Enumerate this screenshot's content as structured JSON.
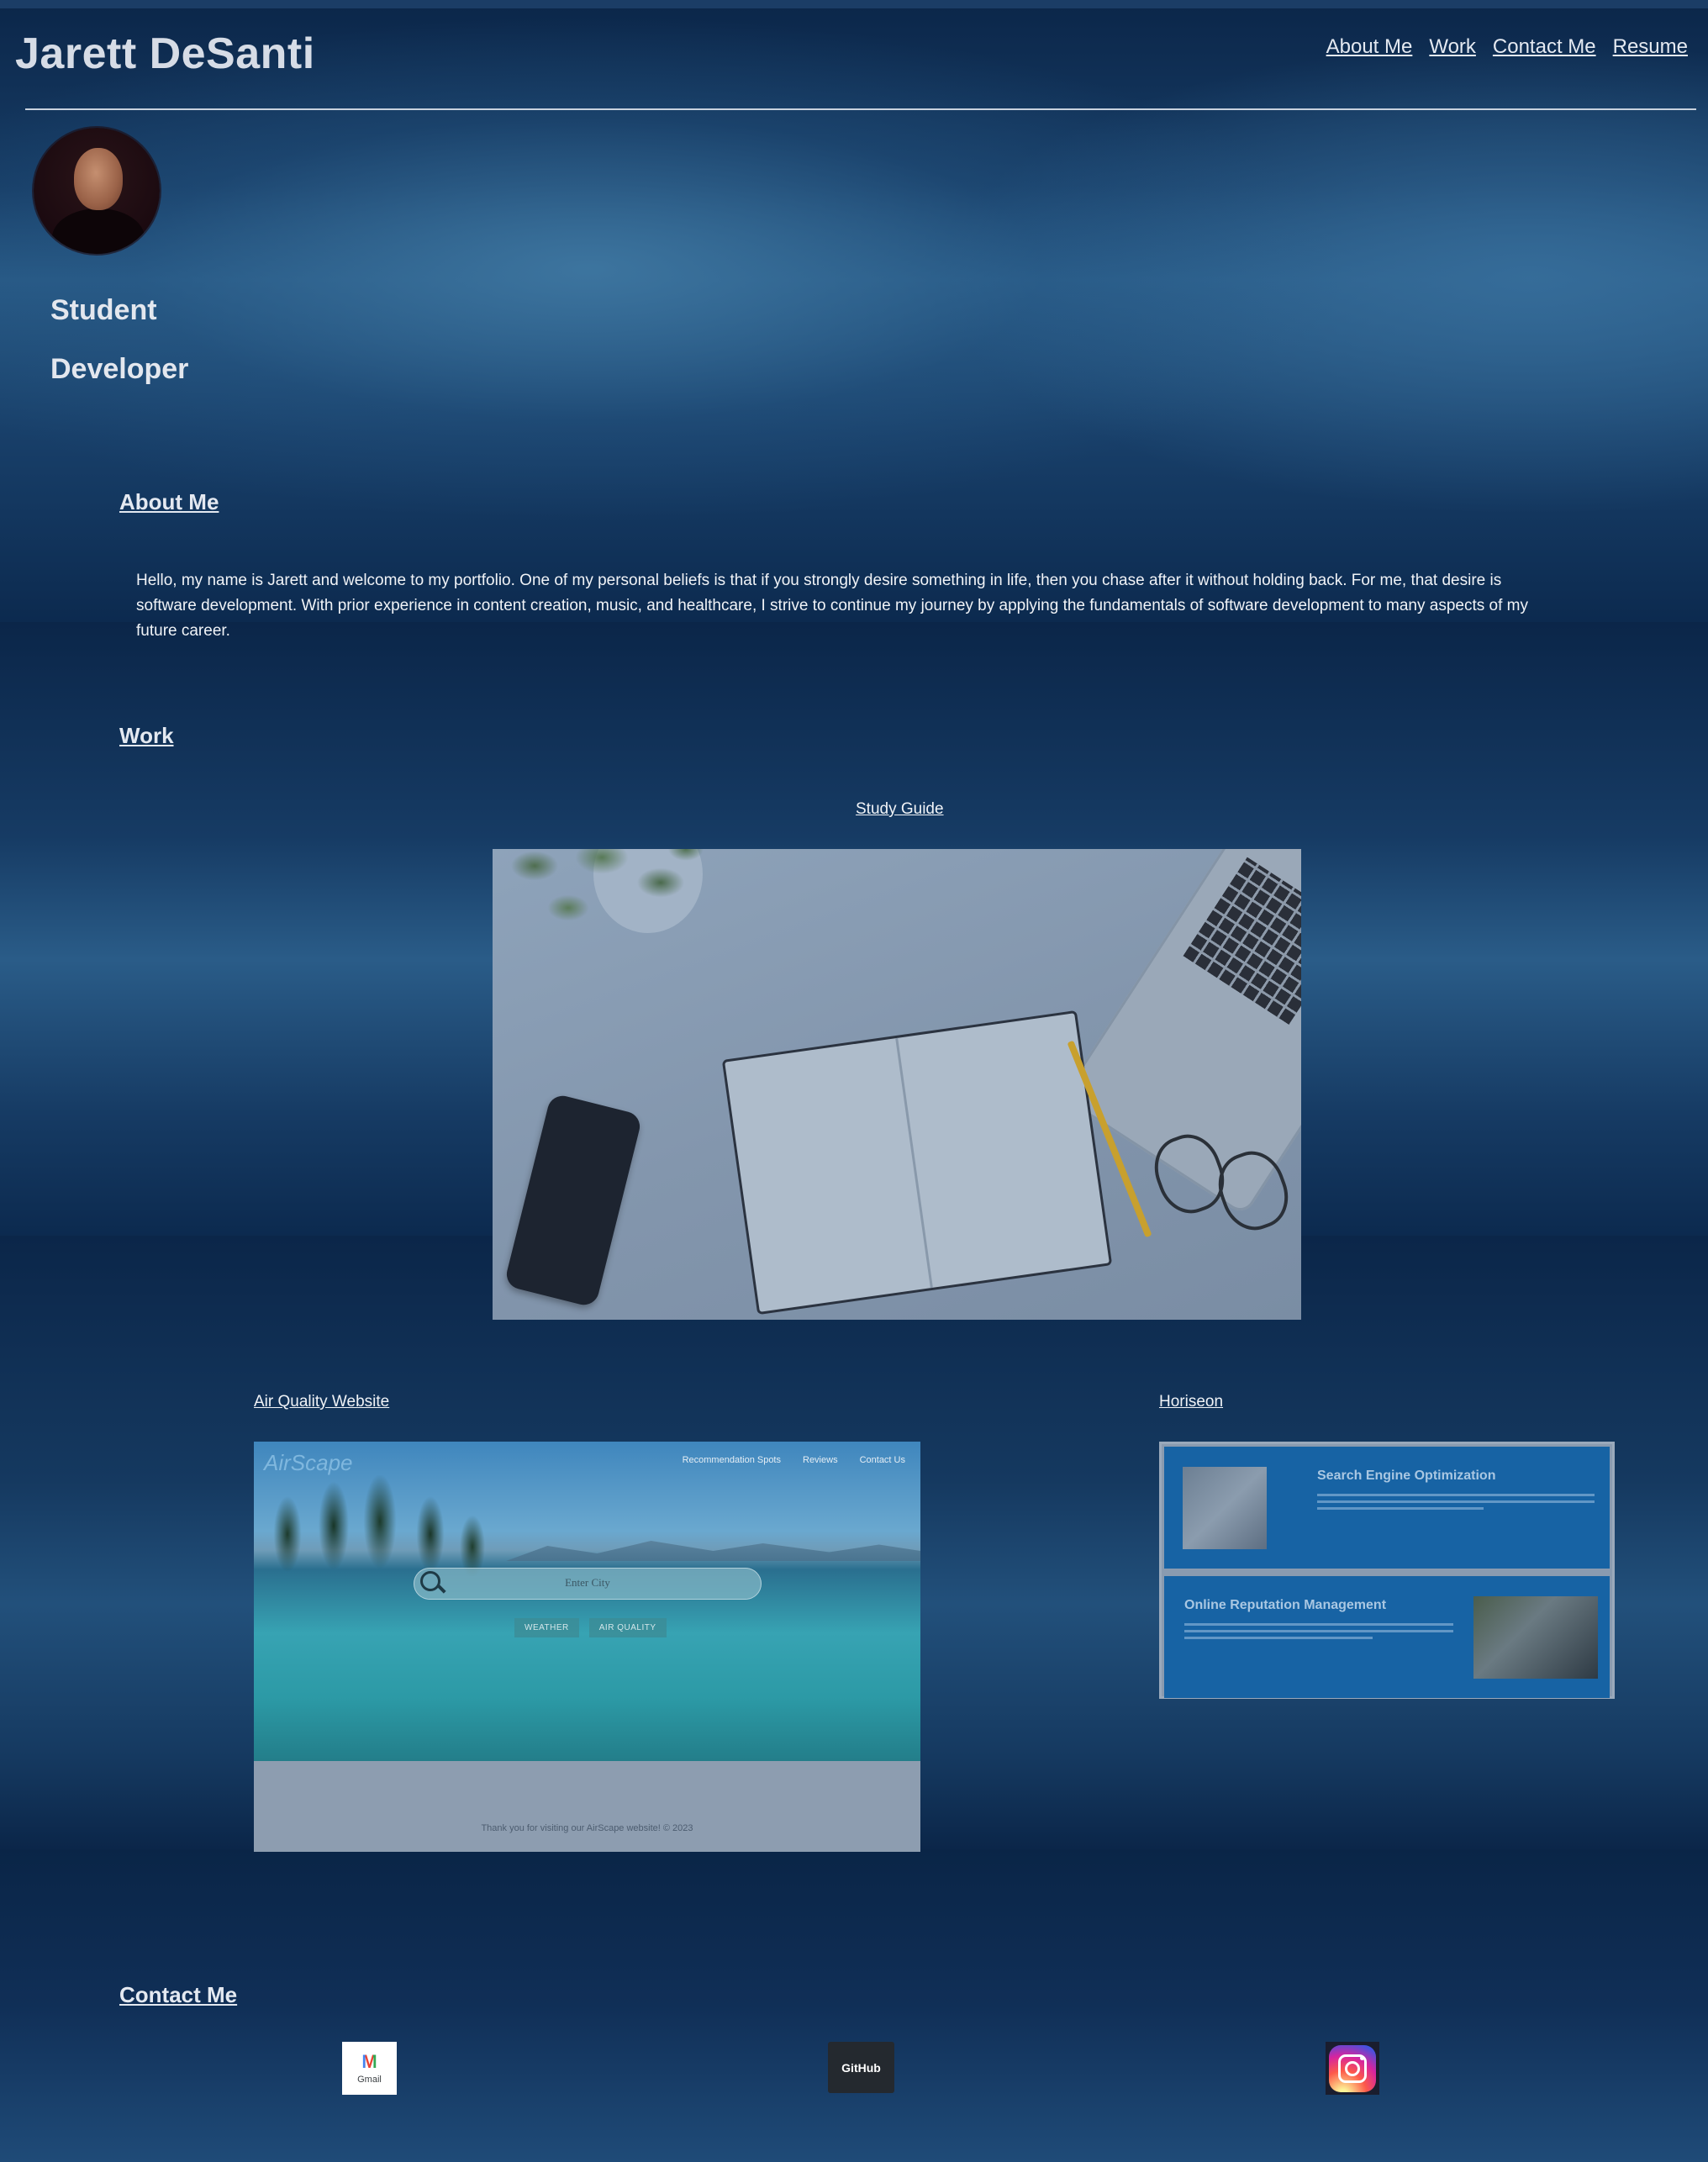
{
  "header": {
    "site_title": "Jarett DeSanti",
    "nav": [
      "About Me",
      "Work",
      "Contact Me",
      "Resume"
    ]
  },
  "hero": {
    "roles": [
      "Student",
      "Developer"
    ]
  },
  "about": {
    "heading": "About Me",
    "text": "Hello, my name is Jarett and welcome to my portfolio. One of my personal beliefs is that if you strongly desire something in life, then you chase after it without holding back. For me, that desire is software development. With prior experience in content creation, music, and healthcare, I strive to continue my journey by applying the fundamentals of software development to many aspects of my future career."
  },
  "work": {
    "heading": "Work",
    "projects": [
      {
        "title": "Study Guide"
      },
      {
        "title": "Air Quality Website",
        "preview": {
          "logo": "AirScape",
          "nav": [
            "Recommendation Spots",
            "Reviews",
            "Contact Us"
          ],
          "search_placeholder": "Enter City",
          "buttons": [
            "WEATHER",
            "AIR QUALITY"
          ],
          "footer": "Thank you for visiting our AirScape website! © 2023"
        }
      },
      {
        "title": "Horiseon",
        "preview": {
          "cards": [
            "Search Engine Optimization",
            "Online Reputation Management"
          ]
        }
      }
    ]
  },
  "contact": {
    "heading": "Contact Me",
    "links": [
      {
        "label": "Gmail",
        "icon": "gmail-icon"
      },
      {
        "label": "GitHub",
        "icon": "github-icon"
      },
      {
        "label": "",
        "icon": "instagram-icon"
      }
    ]
  },
  "colors": {
    "background": "#0a2547",
    "text": "#dfe5ee",
    "horiseon_card": "#1763a4"
  }
}
